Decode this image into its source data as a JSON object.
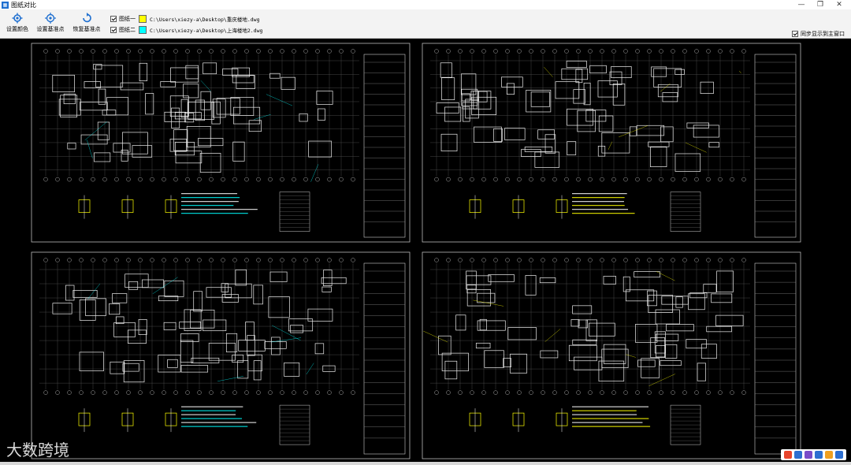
{
  "app": {
    "title": "图纸对比"
  },
  "window_controls": {
    "minimize": "—",
    "maximize": "❐",
    "close": "✕"
  },
  "toolbar": {
    "set_color": "设置颜色",
    "set_base_point": "设置基准点",
    "restore_base_point": "恢复基准点"
  },
  "drawings": [
    {
      "label": "图纸一",
      "color": "#ffff00",
      "path": "C:\\Users\\xiezy-a\\Desktop\\重庆楼地.dwg",
      "checked": true
    },
    {
      "label": "图纸二",
      "color": "#00ffff",
      "path": "C:\\Users\\xiezy-a\\Desktop\\上海楼地2.dwg",
      "checked": true
    }
  ],
  "sync_option": {
    "label": "同步显示到主窗口",
    "checked": true
  },
  "watermark": {
    "text": "大数跨境"
  },
  "colors": {
    "canvas_bg": "#000000",
    "line": "#ffffff",
    "accent_yellow": "#ffff00",
    "accent_cyan": "#00ffff"
  }
}
